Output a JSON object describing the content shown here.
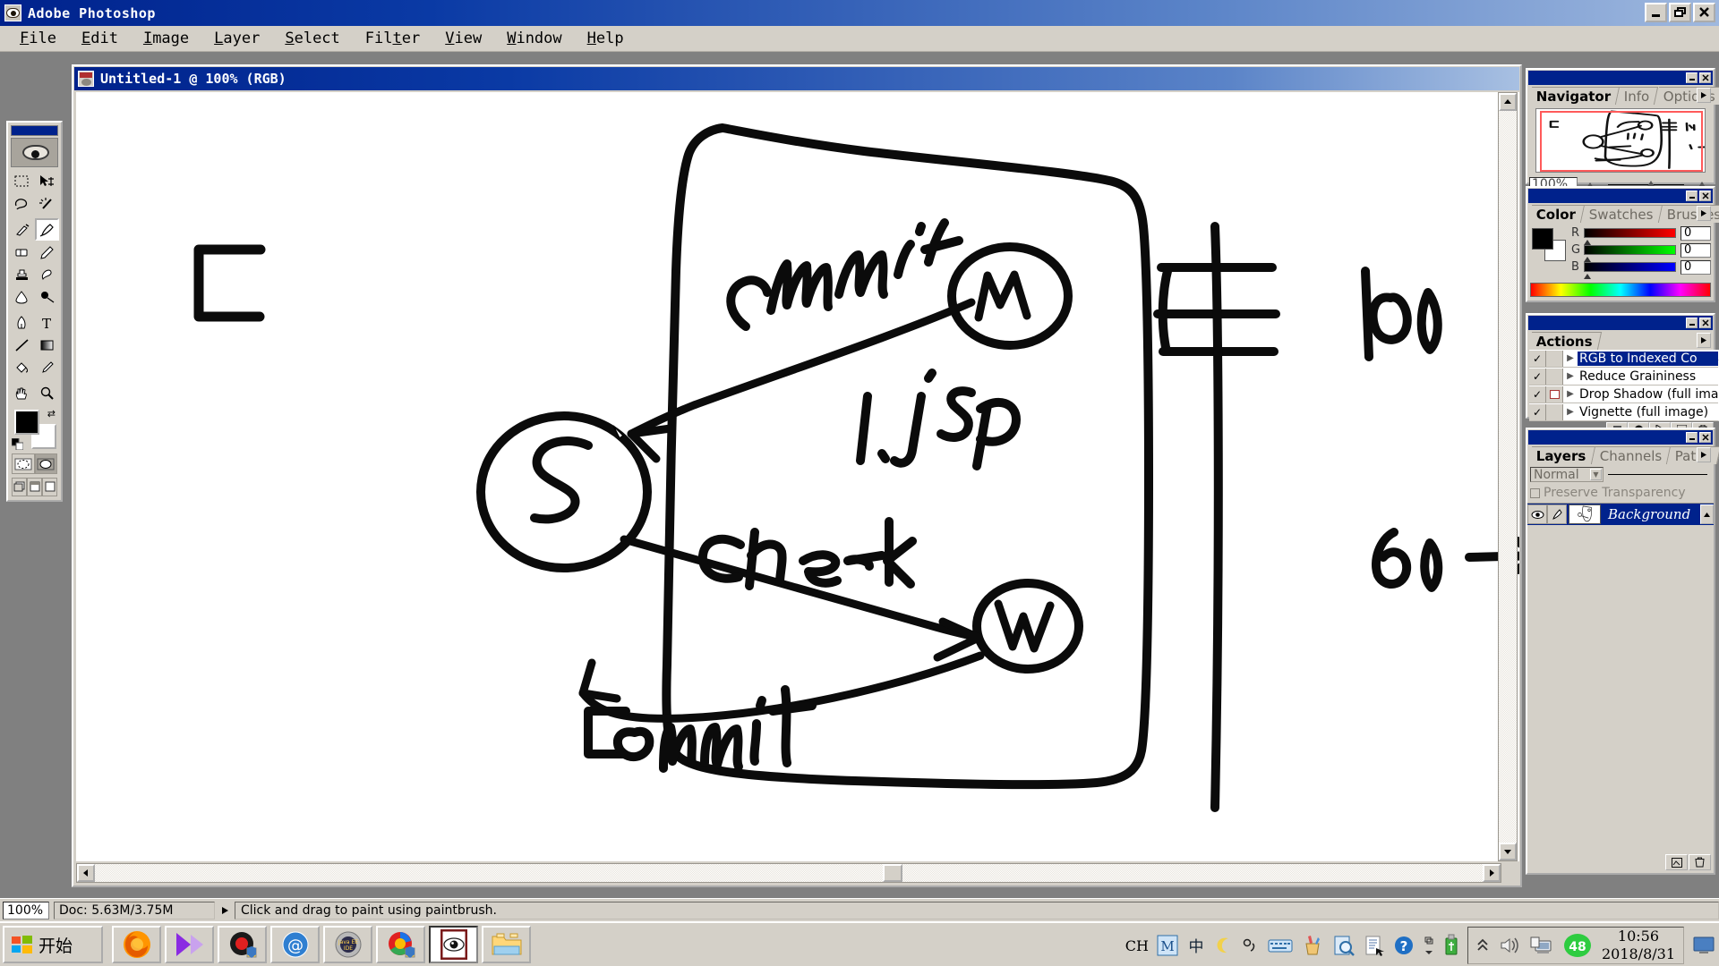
{
  "window": {
    "title": "Adobe Photoshop",
    "app_icon": "photoshop-eye-icon",
    "minimize_label": "–",
    "restore_label": "❐",
    "close_label": "✕"
  },
  "menubar": {
    "items": [
      {
        "pre": "",
        "accel": "F",
        "post": "ile"
      },
      {
        "pre": "",
        "accel": "E",
        "post": "dit"
      },
      {
        "pre": "",
        "accel": "I",
        "post": "mage"
      },
      {
        "pre": "",
        "accel": "L",
        "post": "ayer"
      },
      {
        "pre": "",
        "accel": "S",
        "post": "elect"
      },
      {
        "pre": "Fil",
        "accel": "t",
        "post": "er"
      },
      {
        "pre": "",
        "accel": "V",
        "post": "iew"
      },
      {
        "pre": "",
        "accel": "W",
        "post": "indow"
      },
      {
        "pre": "",
        "accel": "H",
        "post": "elp"
      }
    ]
  },
  "document": {
    "title": "Untitled-1 @ 100%   (RGB)",
    "icon": "document-thumbnail-icon"
  },
  "toolbox": {
    "tools": [
      "marquee-tool",
      "move-tool",
      "lasso-tool",
      "magic-wand-tool",
      "airbrush-tool",
      "paintbrush-tool",
      "eraser-tool",
      "pencil-tool",
      "rubber-stamp-tool",
      "history-brush-tool",
      "blur-tool",
      "dodge-tool",
      "pen-tool",
      "type-tool",
      "line-tool",
      "gradient-tool",
      "paint-bucket-tool",
      "eyedropper-tool",
      "hand-tool",
      "zoom-tool"
    ],
    "selected_tool": "paintbrush-tool",
    "foreground_color": "#000000",
    "background_color": "#ffffff",
    "mask_modes": [
      "standard-mode",
      "quick-mask-mode"
    ],
    "screen_modes": [
      "standard-screen-mode",
      "full-screen-with-menubar",
      "full-screen-mode"
    ]
  },
  "palettes": {
    "navigator": {
      "tabs": [
        "Navigator",
        "Info",
        "Options"
      ],
      "active_tab": "Navigator",
      "zoom_value": "100%"
    },
    "color": {
      "tabs": [
        "Color",
        "Swatches",
        "Brushes"
      ],
      "active_tab": "Color",
      "channels": [
        {
          "label": "R",
          "value": "0",
          "ramp_from": "#000000",
          "ramp_to": "#ff0000"
        },
        {
          "label": "G",
          "value": "0",
          "ramp_from": "#000000",
          "ramp_to": "#00ff00"
        },
        {
          "label": "B",
          "value": "0",
          "ramp_from": "#000000",
          "ramp_to": "#0000ff"
        }
      ]
    },
    "actions": {
      "tabs": [
        "Actions"
      ],
      "active_tab": "Actions",
      "rows": [
        {
          "name": "RGB to Indexed Co",
          "checked": true,
          "has_dialog": false,
          "selected": true
        },
        {
          "name": "Reduce Graininess",
          "checked": true,
          "has_dialog": false,
          "selected": false
        },
        {
          "name": "Drop Shadow (full ima",
          "checked": true,
          "has_dialog": true,
          "selected": false
        },
        {
          "name": "Vignette (full image)",
          "checked": true,
          "has_dialog": false,
          "selected": false
        }
      ],
      "footer_buttons": [
        "stop-button",
        "record-button",
        "play-button",
        "new-action-button",
        "delete-button"
      ]
    },
    "layers": {
      "tabs": [
        "Layers",
        "Channels",
        "Paths"
      ],
      "active_tab": "Layers",
      "blend_mode": "Normal",
      "preserve_transparency_label": "Preserve Transparency",
      "preserve_transparency_checked": false,
      "rows": [
        {
          "name": "Background",
          "visible": true,
          "active": true
        }
      ],
      "footer_buttons": [
        "new-layer-button",
        "delete-layer-button"
      ]
    }
  },
  "statusbar": {
    "zoom": "100%",
    "doc_size": "Doc: 5.63M/3.75M",
    "message": "Click and drag to paint using paintbrush."
  },
  "taskbar": {
    "start_label": "开始",
    "quick_launch": [
      "firefox-icon",
      "media-player-icon",
      "recorder-icon",
      "outlook-express-icon",
      "java-ee-ide-icon",
      "chrome-icon",
      "photoshop-icon",
      "folder-icon"
    ],
    "active_item": "photoshop-icon",
    "tray": {
      "language": "CH",
      "icons": [
        "mcafee-icon",
        "chinese-ime-icon",
        "moon-icon",
        "comma-icon",
        "keyboard-icon",
        "pencil-cup-icon",
        "magnifier-doc-icon",
        "document-icon",
        "help-icon",
        "overflow-icon",
        "usb-icon"
      ],
      "hidden_chevron": "chevron-up-icon",
      "volume_icon": "volume-icon",
      "network_icon": "network-icon",
      "badge": "48",
      "time": "10:56",
      "date": "2018/8/31",
      "show_desktop_icon": "show-desktop-icon"
    }
  },
  "canvas_sketch": {
    "description": "hand-drawn whiteboard-style diagram on white canvas",
    "labels": [
      {
        "text": "C",
        "note": "bracket glyph at left"
      },
      {
        "text": "commit",
        "note": "top arrow label"
      },
      {
        "text": "M",
        "note": "circled node top right"
      },
      {
        "text": "1.jsp",
        "note": "center label"
      },
      {
        "text": "S",
        "note": "circled node left"
      },
      {
        "text": "check",
        "note": "middle arrow label"
      },
      {
        "text": "W",
        "note": "circled node right"
      },
      {
        "text": "commit",
        "note": "bottom arrow label"
      },
      {
        "text": "60",
        "note": "upper right"
      },
      {
        "text": "60",
        "note": "lower right with arrow"
      }
    ]
  }
}
